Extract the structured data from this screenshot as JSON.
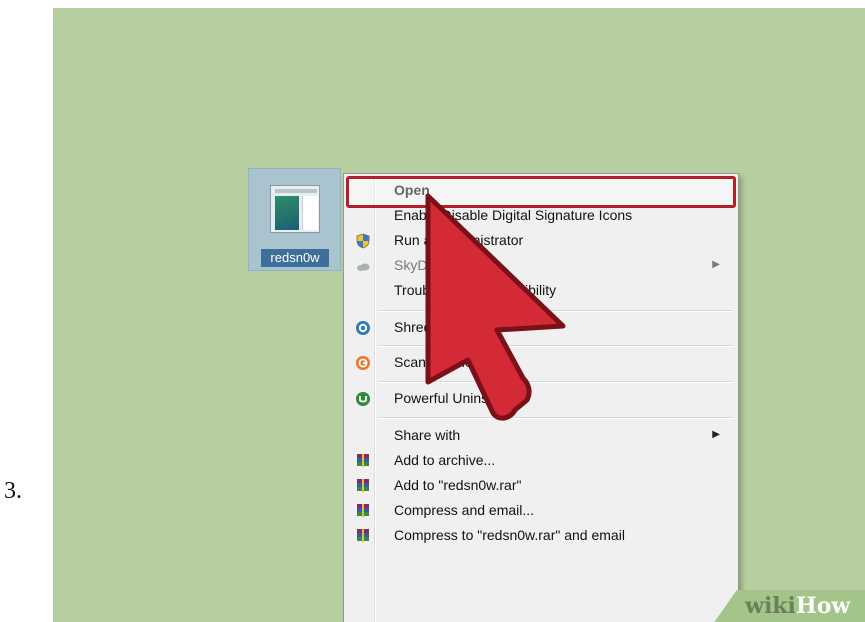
{
  "step": {
    "number": "3."
  },
  "desktop": {
    "icon_label": "redsn0w"
  },
  "context_menu": {
    "items": [
      {
        "label": "Open",
        "icon": "none",
        "submenu": false,
        "disabled": false
      },
      {
        "label": "Enable/Disable Digital Signature Icons",
        "icon": "none",
        "submenu": false,
        "disabled": false
      },
      {
        "label": "Run as administrator",
        "icon": "uac-shield-icon",
        "submenu": false,
        "disabled": false
      },
      {
        "label": "SkyDrive",
        "icon": "skydrive-cloud-icon",
        "submenu": true,
        "disabled": true
      },
      {
        "label": "Troubleshoot compatibility",
        "icon": "none",
        "submenu": false,
        "disabled": false
      },
      {
        "label": "Shred file",
        "icon": "shred-icon",
        "submenu": false,
        "disabled": false
      },
      {
        "label": "Scan redsn0w.exe",
        "icon": "antivirus-icon",
        "submenu": false,
        "disabled": false
      },
      {
        "label": "Powerful Uninstall",
        "icon": "uninstall-icon",
        "submenu": false,
        "disabled": false
      },
      {
        "label": "Share with",
        "icon": "none",
        "submenu": true,
        "disabled": false
      },
      {
        "label": "Add to archive...",
        "icon": "winrar-icon",
        "submenu": false,
        "disabled": false
      },
      {
        "label": "Add to \"redsn0w.rar\"",
        "icon": "winrar-icon",
        "submenu": false,
        "disabled": false
      },
      {
        "label": "Compress and email...",
        "icon": "winrar-icon",
        "submenu": false,
        "disabled": false
      },
      {
        "label": "Compress to \"redsn0w.rar\" and email",
        "icon": "winrar-icon",
        "submenu": false,
        "disabled": false
      }
    ]
  },
  "watermark": {
    "part1": "wiki",
    "part2": "How"
  },
  "colors": {
    "desktop": "#b7cfa0",
    "highlight": "#b4202a",
    "cursor": "#d42a35"
  }
}
